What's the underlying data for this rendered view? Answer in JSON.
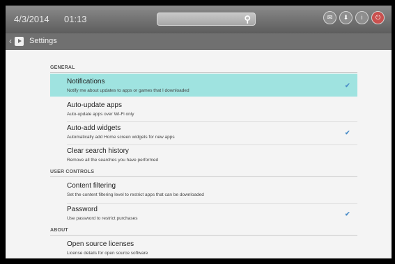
{
  "status_bar": {
    "date": "4/3/2014",
    "time": "01:13",
    "icons": [
      {
        "name": "mail-icon",
        "glyph": "✉"
      },
      {
        "name": "download-icon",
        "glyph": "⬇"
      },
      {
        "name": "info-icon",
        "glyph": "i"
      },
      {
        "name": "power-icon",
        "glyph": "⏻",
        "color": "#c9504e"
      }
    ]
  },
  "action_bar": {
    "title": "Settings"
  },
  "sections": [
    {
      "header": "GENERAL",
      "items": [
        {
          "title": "Notifications",
          "summary": "Notify me about updates to apps or games that I downloaded",
          "checked": true,
          "highlight": true
        },
        {
          "title": "Auto-update apps",
          "summary": "Auto-update apps over Wi-Fi only",
          "checked": false
        },
        {
          "title": "Auto-add widgets",
          "summary": "Automatically add Home screen widgets for new apps",
          "checked": true
        },
        {
          "title": "Clear search history",
          "summary": "Remove all the searches you have performed",
          "checked": false
        }
      ]
    },
    {
      "header": "USER CONTROLS",
      "items": [
        {
          "title": "Content filtering",
          "summary": "Set the content filtering level to restrict apps that can be downloaded",
          "checked": false
        },
        {
          "title": "Password",
          "summary": "Use password to restrict purchases",
          "checked": true
        }
      ]
    },
    {
      "header": "ABOUT",
      "items": [
        {
          "title": "Open source licenses",
          "summary": "License details for open source software",
          "checked": false
        }
      ]
    }
  ],
  "colors": {
    "highlight": "#9fe3e0",
    "checkmark": "#4a8cc7"
  }
}
